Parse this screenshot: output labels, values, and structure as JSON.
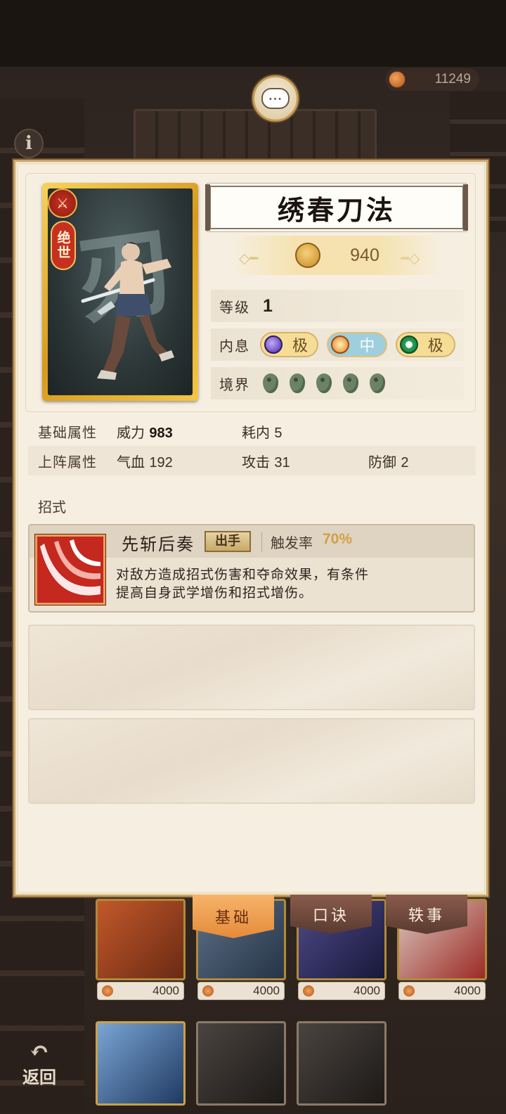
{
  "top_bar": {
    "currency_value": "11249"
  },
  "panel": {
    "card_rank": "绝世",
    "card_glyph": "刃",
    "title": "绣春刀法",
    "power": "940",
    "level_label": "等级",
    "level_value": "1",
    "neixi_label": "内息",
    "neixi": [
      {
        "text": "极",
        "color": "#4a2a9c"
      },
      {
        "text": "中",
        "color": "#e87b22"
      },
      {
        "text": "极",
        "color": "#2aa65a"
      }
    ],
    "realm_label": "境界",
    "realm_count": 5
  },
  "stats": {
    "base_label": "基础属性",
    "base": [
      {
        "name": "威力",
        "value": "983"
      },
      {
        "name": "耗内",
        "value": "5"
      }
    ],
    "battle_label": "上阵属性",
    "battle": [
      {
        "name": "气血",
        "value": "192"
      },
      {
        "name": "攻击",
        "value": "31"
      },
      {
        "name": "防御",
        "value": "2"
      }
    ]
  },
  "moves": {
    "section_label": "招式",
    "skill": {
      "name": "先斩后奏",
      "tag": "出手",
      "rate_label": "触发率",
      "rate": "70%",
      "desc_line1": "对敌方造成招式伤害和夺命效果，有条件",
      "desc_line2": "提高自身武学增伤和招式增伤。"
    }
  },
  "tabs": [
    {
      "label": "基础",
      "active": true
    },
    {
      "label": "口诀",
      "active": false
    },
    {
      "label": "轶事",
      "active": false
    }
  ],
  "shop": {
    "prices": [
      "4000",
      "4000",
      "4000",
      "4000"
    ]
  },
  "back_label": "返回",
  "colors": {
    "accent_gold": "#d79a1e",
    "panel_bg": "#f6efe1",
    "tab_active": "#e58b3a",
    "rate_color": "#d0a04a"
  }
}
